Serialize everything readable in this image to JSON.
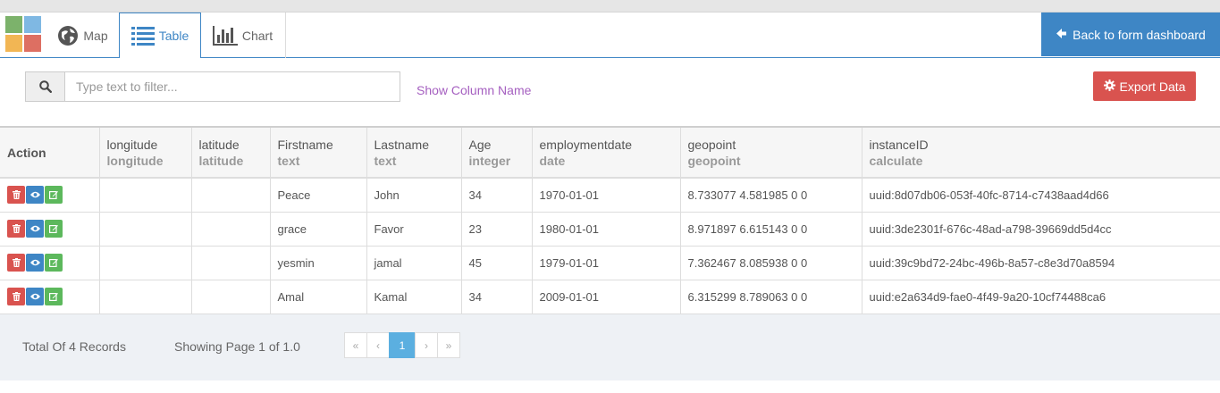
{
  "nav": {
    "tabs": [
      {
        "label": "Map",
        "icon": "globe-icon"
      },
      {
        "label": "Table",
        "icon": "list-icon"
      },
      {
        "label": "Chart",
        "icon": "bar-chart-icon"
      }
    ],
    "active_tab": "Table",
    "back_label": "Back to form dashboard"
  },
  "toolbar": {
    "search_placeholder": "Type text to filter...",
    "search_value": "",
    "show_column_label": "Show Column Name",
    "export_label": "Export Data"
  },
  "table": {
    "action_header": "Action",
    "columns": [
      {
        "name": "longitude",
        "type": "longitude"
      },
      {
        "name": "latitude",
        "type": "latitude"
      },
      {
        "name": "Firstname",
        "type": "text"
      },
      {
        "name": "Lastname",
        "type": "text"
      },
      {
        "name": "Age",
        "type": "integer"
      },
      {
        "name": "employmentdate",
        "type": "date"
      },
      {
        "name": "geopoint",
        "type": "geopoint"
      },
      {
        "name": "instanceID",
        "type": "calculate"
      }
    ],
    "rows": [
      [
        "",
        "",
        "Peace",
        "John",
        "34",
        "1970-01-01",
        "8.733077 4.581985 0 0",
        "uuid:8d07db06-053f-40fc-8714-c7438aad4d66"
      ],
      [
        "",
        "",
        "grace",
        "Favor",
        "23",
        "1980-01-01",
        "8.971897 6.615143 0 0",
        "uuid:3de2301f-676c-48ad-a798-39669dd5d4cc"
      ],
      [
        "",
        "",
        "yesmin",
        "jamal",
        "45",
        "1979-01-01",
        "7.362467 8.085938 0 0",
        "uuid:39c9bd72-24bc-496b-8a57-c8e3d70a8594"
      ],
      [
        "",
        "",
        "Amal",
        "Kamal",
        "34",
        "2009-01-01",
        "6.315299 8.789063 0 0",
        "uuid:e2a634d9-fae0-4f49-9a20-10cf74488ca6"
      ]
    ]
  },
  "footer": {
    "total_text": "Total Of 4 Records",
    "showing_text": "Showing Page 1 of 1.0",
    "pager": [
      "«",
      "‹",
      "1",
      "›",
      "»"
    ],
    "current_page": "1"
  },
  "colors": {
    "primary": "#3e86c5",
    "danger": "#d9534f",
    "success": "#5cb85c",
    "link_purple": "#a55fc0"
  }
}
